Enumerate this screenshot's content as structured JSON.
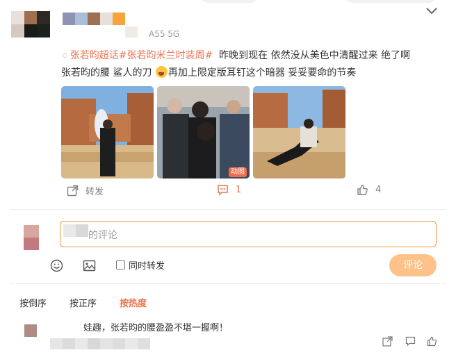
{
  "post": {
    "meta_suffix": "A55 5G",
    "hashtags": [
      "张若昀超话",
      "#张若昀米兰时装周#"
    ],
    "text_line1": "昨晚到现在 依然没从美色中清醒过来 绝了啊",
    "text_line2a": "张若昀的腰 鲨人的刀",
    "text_line2b": "再加上限定版耳钉这个暗器 妥妥要命的节奏",
    "emoji_icon": "laughing-emoji",
    "photo_badge": "动图",
    "photo_count": 3
  },
  "actions": {
    "repost_label": "转发",
    "comment_count": "1",
    "like_count": "4"
  },
  "reply": {
    "placeholder_visible": "的评论",
    "repost_checkbox_label": "同时转发",
    "repost_checked": false,
    "submit_label": "评论"
  },
  "sort_tabs": [
    {
      "label": "按倒序",
      "active": false
    },
    {
      "label": "按正序",
      "active": false
    },
    {
      "label": "按热度",
      "active": true
    }
  ],
  "comments": [
    {
      "text": "娃趣，张若昀的腰盈盈不堪一握啊！"
    }
  ],
  "colors": {
    "accent": "#eb7350",
    "submit_bg": "#fcc28a",
    "reply_border": "#eb9b3d",
    "muted": "#808080"
  },
  "icons": [
    "chevron-down-icon",
    "repost-icon",
    "comment-icon",
    "like-icon",
    "emoji-icon",
    "image-icon",
    "share-icon",
    "reply-icon"
  ]
}
